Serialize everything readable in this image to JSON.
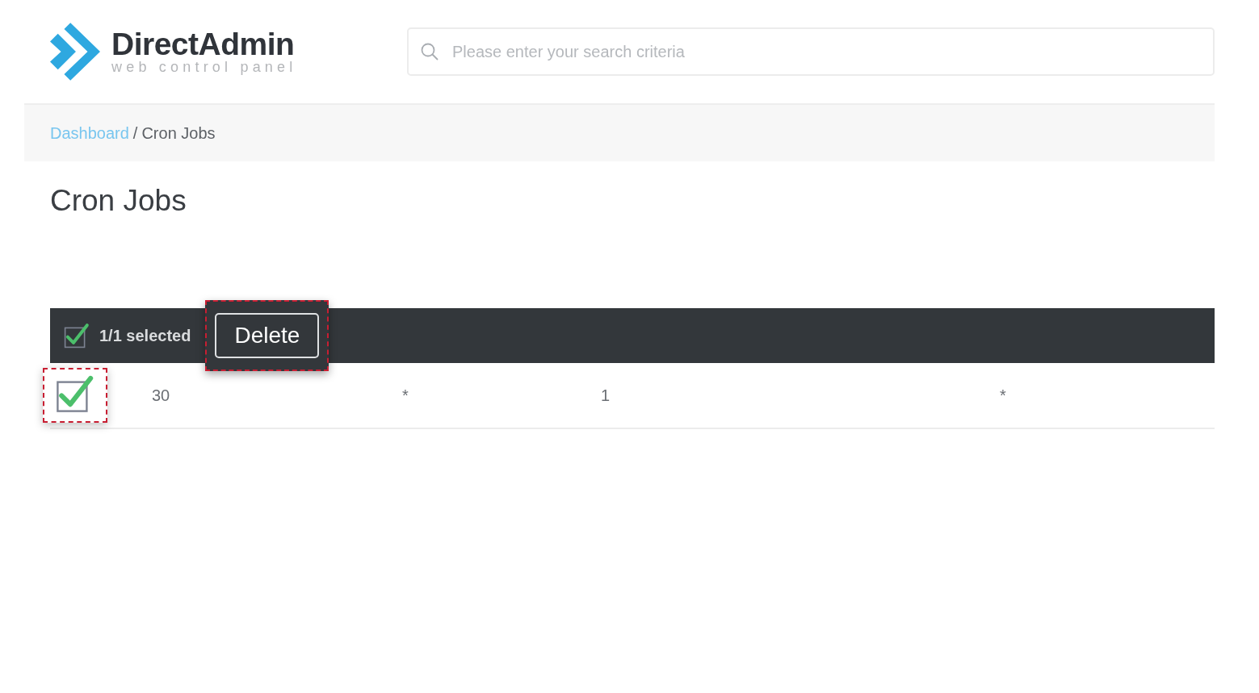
{
  "logo": {
    "name": "DirectAdmin",
    "tagline": "web control panel"
  },
  "search": {
    "placeholder": "Please enter your search criteria"
  },
  "breadcrumb": {
    "separator": "/",
    "items": [
      {
        "label": "Dashboard",
        "kind": "link"
      },
      {
        "label": "Cron Jobs",
        "kind": "current"
      }
    ]
  },
  "page_title": "Cron Jobs",
  "bulk_bar": {
    "checked": true,
    "selected_text": "1/1 selected",
    "action": {
      "label": "Delete",
      "highlighted": true
    }
  },
  "rows": [
    {
      "checked": true,
      "highlighted": true,
      "cells": [
        "30",
        "*",
        "1",
        "*"
      ]
    }
  ]
}
